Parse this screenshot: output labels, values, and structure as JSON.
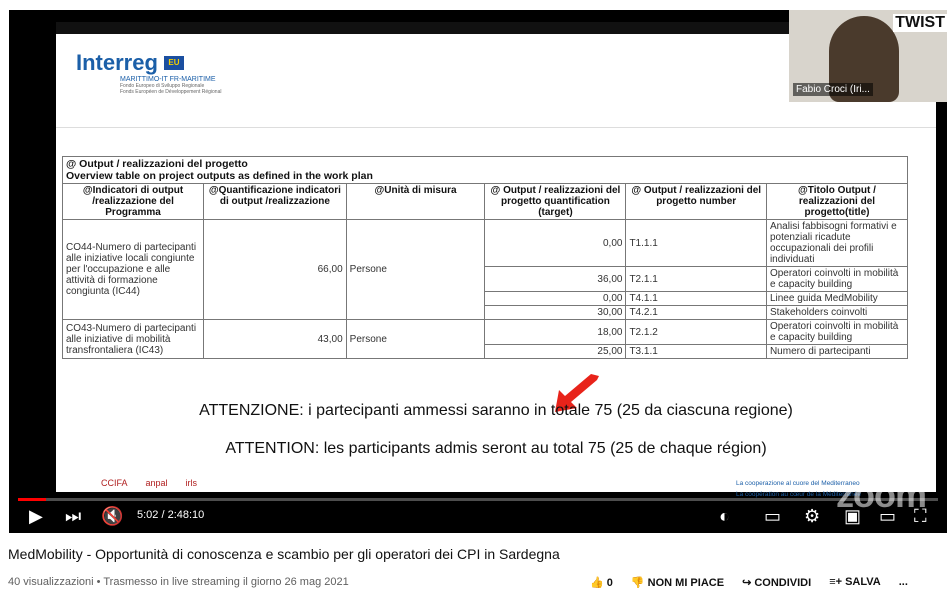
{
  "slide": {
    "logo_text": "Interreg",
    "logo_eu": "EU",
    "logo_program": "MARITTIMO-IT FR-MARITIME",
    "logo_fund": "Fondo Europeo di Sviluppo Regionale",
    "logo_fund2": "Fonds Européen de Développement Régional",
    "table_caption_1": "@ Output / realizzazioni del progetto",
    "table_caption_2": "Overview table on project outputs as defined in the work plan",
    "headers": [
      "@Indicatori di output /realizzazione del Programma",
      "@Quantificazione indicatori di output /realizzazione",
      "@Unità di misura",
      "@ Output / realizzazioni del progetto quantification (target)",
      "@ Output / realizzazioni del progetto number",
      "@Titolo Output / realizzazioni del progetto(title)"
    ],
    "groups": [
      {
        "indicator": "CO44-Numero di partecipanti alle iniziative locali congiunte per l'occupazione e alle attività di formazione congiunta (IC44)",
        "quantification": "66,00",
        "unit": "Persone",
        "rows": [
          {
            "target": "0,00",
            "number": "T1.1.1",
            "title": "Analisi fabbisogni formativi e potenziali ricadute occupazionali dei profili individuati"
          },
          {
            "target": "36,00",
            "number": "T2.1.1",
            "title": "Operatori coinvolti in mobilità e capacity building"
          },
          {
            "target": "0,00",
            "number": "T4.1.1",
            "title": "Linee guida MedMobility"
          },
          {
            "target": "30,00",
            "number": "T4.2.1",
            "title": "Stakeholders coinvolti"
          }
        ]
      },
      {
        "indicator": "CO43-Numero di partecipanti alle iniziative di mobilità transfrontaliera (IC43)",
        "quantification": "43,00",
        "unit": "Persone",
        "rows": [
          {
            "target": "18,00",
            "number": "T2.1.2",
            "title": "Operatori coinvolti in mobilità e capacity building"
          },
          {
            "target": "25,00",
            "number": "T3.1.1",
            "title": "Numero di partecipanti"
          }
        ]
      }
    ],
    "attention_it": "ATTENZIONE: i partecipanti ammessi saranno in totale 75 (25 da ciascuna regione)",
    "attention_fr": "ATTENTION: les participants admis seront au total 75 (25 de chaque région)",
    "footer_logos": [
      "CCIFA",
      "anpal",
      "irls"
    ],
    "coop_1": "La cooperazione al cuore del Mediterraneo",
    "coop_2": "La coopération au cœur de la Méditerranée",
    "zoom": "zoom"
  },
  "webcam": {
    "banner": "TWIST",
    "name": "Fabio Croci (Iri..."
  },
  "player": {
    "time": "5:02 / 2:48:10",
    "progress": 0.03,
    "accent": "#ff0000"
  },
  "video": {
    "title": "MedMobility - Opportunità di conoscenza e scambio per gli operatori dei CPI in Sardegna",
    "meta": "40 visualizzazioni • Trasmesso in live streaming il giorno 26 mag 2021",
    "likes": "0",
    "dislike_label": "NON MI PIACE",
    "share_label": "CONDIVIDI",
    "save_label": "SALVA",
    "more_label": "..."
  }
}
